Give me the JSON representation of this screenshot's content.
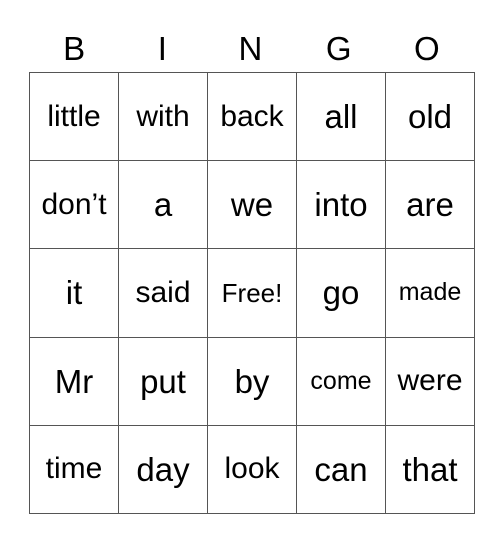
{
  "header": {
    "letters": [
      "B",
      "I",
      "N",
      "G",
      "O"
    ]
  },
  "board": {
    "rows": [
      [
        "little",
        "with",
        "back",
        "all",
        "old"
      ],
      [
        "don’t",
        "a",
        "we",
        "into",
        "are"
      ],
      [
        "it",
        "said",
        "Free!",
        "go",
        "made"
      ],
      [
        "Mr",
        "put",
        "by",
        "come",
        "were"
      ],
      [
        "time",
        "day",
        "look",
        "can",
        "that"
      ]
    ],
    "free_space": "Free!"
  }
}
